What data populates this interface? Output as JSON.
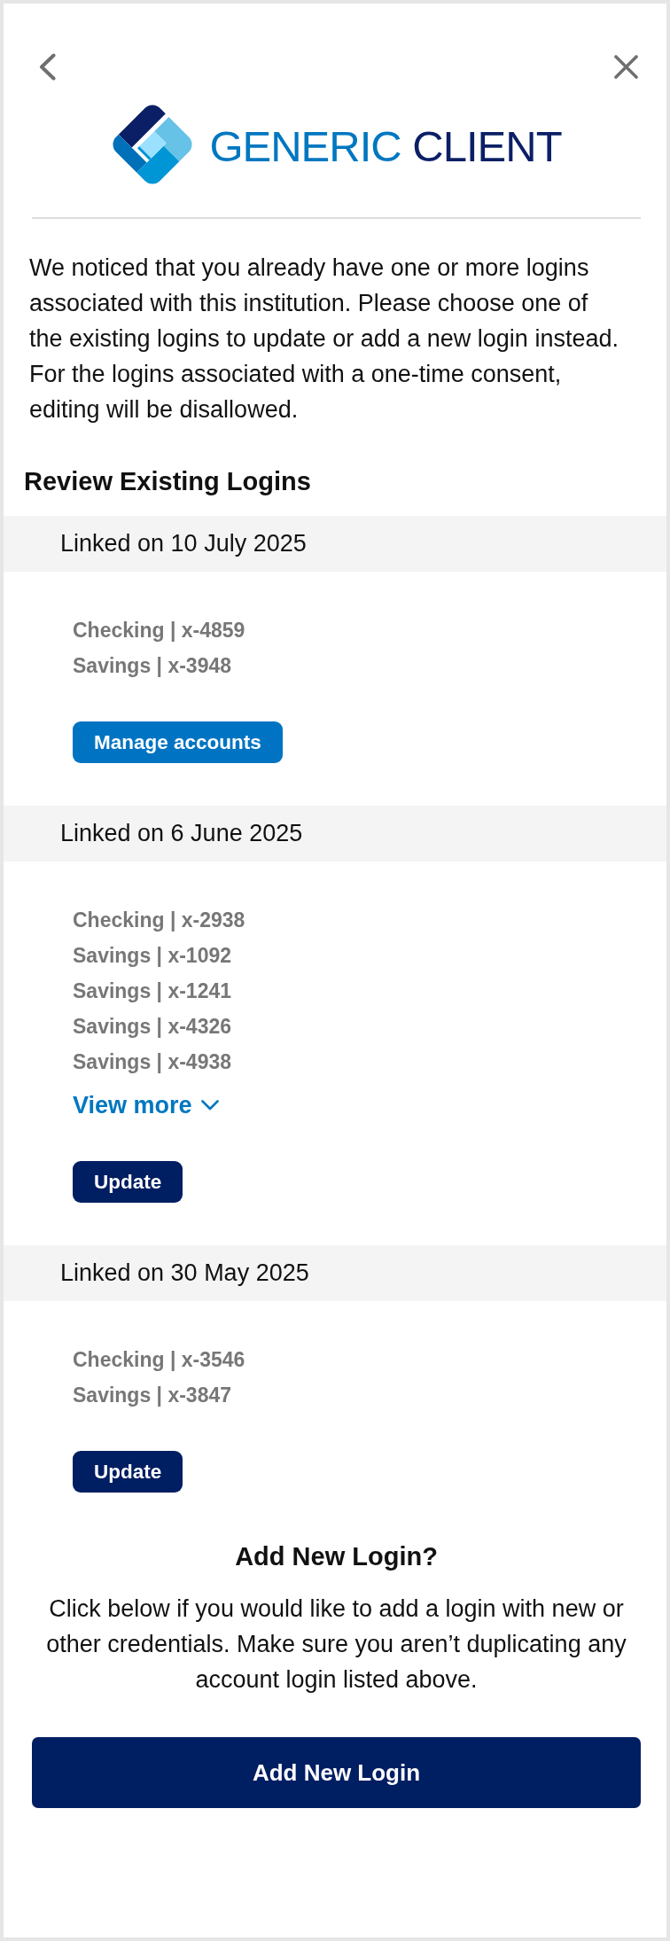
{
  "logo": {
    "words": [
      "GENERIC",
      "CLIENT"
    ]
  },
  "intro": "We noticed that you already have one or more logins associated with this institution. Please choose one of the existing logins to update or add a new login instead. For the logins associated with a one-time consent, editing will be disallowed.",
  "section_title": "Review Existing Logins",
  "logins": [
    {
      "linked": "Linked on 10 July 2025",
      "accounts": [
        "Checking | x-4859",
        "Savings | x-3948"
      ],
      "action": {
        "kind": "manage",
        "label": "Manage accounts"
      }
    },
    {
      "linked": "Linked on 6 June 2025",
      "accounts": [
        "Checking | x-2938",
        "Savings | x-1092",
        "Savings | x-1241",
        "Savings | x-4326",
        "Savings | x-4938"
      ],
      "more_link": "View more",
      "action": {
        "kind": "update",
        "label": "Update"
      }
    },
    {
      "linked": "Linked on 30 May 2025",
      "accounts": [
        "Checking | x-3546",
        "Savings | x-3847"
      ],
      "action": {
        "kind": "update",
        "label": "Update"
      }
    }
  ],
  "add_new": {
    "title": "Add New Login?",
    "text": "Click below if you would like to add a login with new or other credentials. Make sure you aren’t duplicating any account login listed above.",
    "button": "Add New Login"
  }
}
